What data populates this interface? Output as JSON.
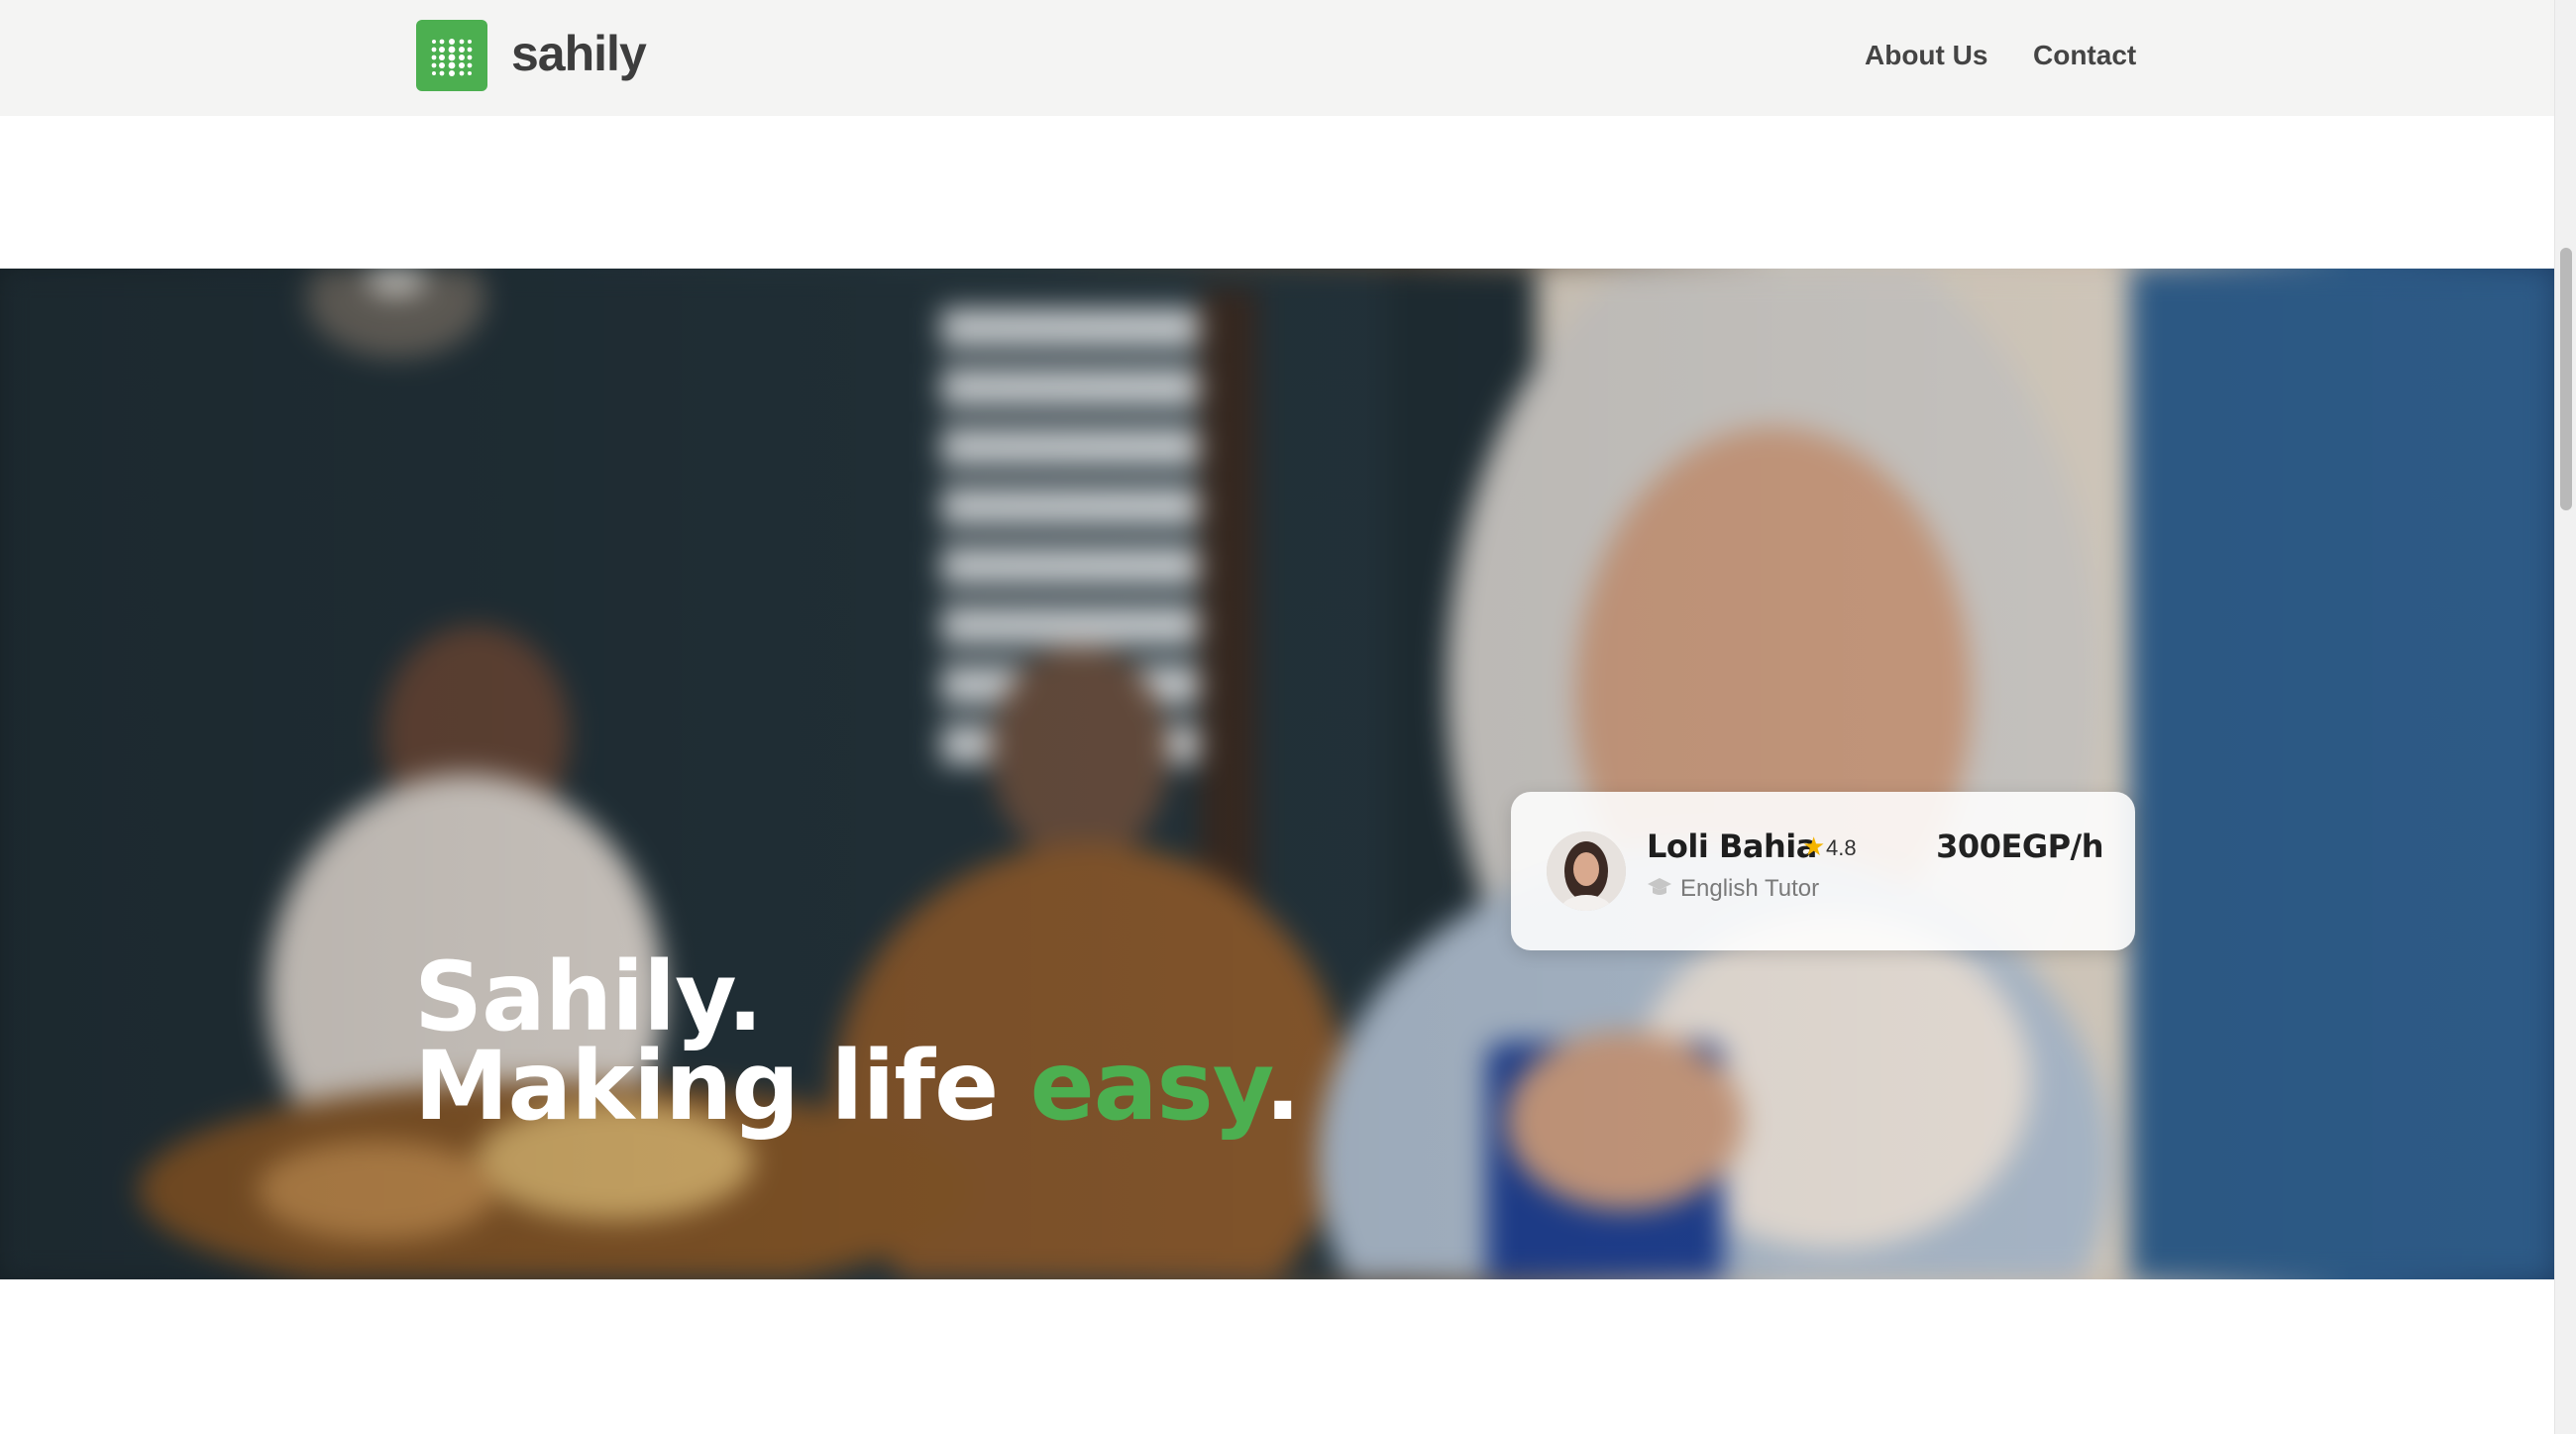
{
  "header": {
    "brand": "sahily",
    "nav": [
      {
        "label": "About Us"
      },
      {
        "label": "Contact"
      }
    ]
  },
  "hero": {
    "line1": "Sahily.",
    "line2_prefix": "Making life ",
    "line2_accent": "easy",
    "line2_suffix": "."
  },
  "tutor_card": {
    "name": "Loli Bahia",
    "rating": "4.8",
    "subject": "English Tutor",
    "price": "300EGP/h"
  },
  "colors": {
    "accent": "#4caf50",
    "header_bg": "#f4f4f3",
    "star": "#f4b400"
  },
  "icons": [
    "logo-dots-icon",
    "star-icon",
    "graduation-cap-icon",
    "avatar"
  ]
}
